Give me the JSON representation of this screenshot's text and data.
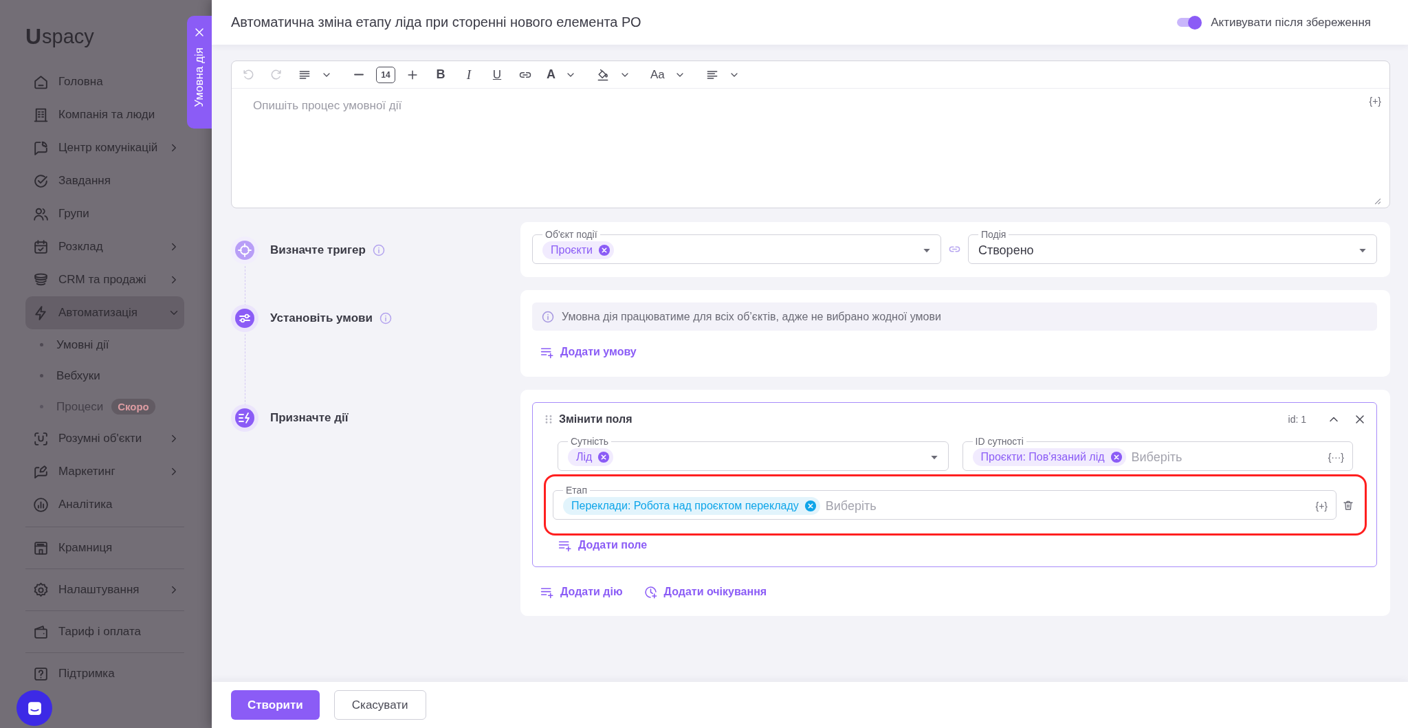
{
  "sidebar": {
    "logo": {
      "mark": "U",
      "text": "spacy"
    },
    "groups": [
      {
        "items": [
          {
            "kind": "home",
            "label": "Головна",
            "expandable": false,
            "expanded": false
          },
          {
            "kind": "company",
            "label": "Компанія та люди",
            "expandable": false,
            "expanded": false
          },
          {
            "kind": "communications",
            "label": "Центр комунікацій",
            "expandable": true,
            "expanded": false
          },
          {
            "kind": "tasks",
            "label": "Завдання",
            "expandable": false,
            "expanded": false
          },
          {
            "kind": "groups",
            "label": "Групи",
            "expandable": false,
            "expanded": false
          },
          {
            "kind": "schedule",
            "label": "Розклад",
            "expandable": true,
            "expanded": false
          },
          {
            "kind": "crm",
            "label": "CRM та продажі",
            "expandable": true,
            "expanded": false
          },
          {
            "kind": "automation",
            "label": "Автоматизація",
            "expandable": true,
            "expanded": true,
            "children": [
              {
                "label": "Умовні дії",
                "disabled": false
              },
              {
                "label": "Вебхуки",
                "disabled": false
              },
              {
                "label": "Процеси",
                "disabled": true,
                "badge": "Скоро"
              }
            ]
          },
          {
            "kind": "smart",
            "label": "Розумні об'єкти",
            "expandable": true,
            "expanded": false
          },
          {
            "kind": "marketing",
            "label": "Маркетинг",
            "expandable": true,
            "expanded": false
          },
          {
            "kind": "analytics",
            "label": "Аналітика",
            "expandable": false,
            "expanded": false
          }
        ]
      },
      {
        "items": [
          {
            "kind": "store",
            "label": "Крамниця",
            "expandable": false,
            "expanded": false
          }
        ]
      },
      {
        "items": [
          {
            "kind": "settings",
            "label": "Налаштування",
            "expandable": true,
            "expanded": false
          }
        ]
      },
      {
        "items": [
          {
            "kind": "billing",
            "label": "Тариф і оплата",
            "expandable": false,
            "expanded": false
          }
        ]
      },
      {
        "items": [
          {
            "kind": "support",
            "label": "Підтримка",
            "expandable": false,
            "expanded": false
          }
        ]
      }
    ]
  },
  "side_tab": {
    "label": "Умовна дія"
  },
  "header": {
    "title": "Автоматична зміна етапу ліда при сторенні нового елемента РО",
    "activate_toggle": {
      "label": "Активувати після збереження",
      "on": true
    }
  },
  "editor": {
    "toolbar": [
      {
        "kind": "undo",
        "disabled": true
      },
      {
        "kind": "redo",
        "disabled": true
      },
      {
        "kind": "paragraph",
        "dropdown": true
      },
      {
        "kind": "minus"
      },
      {
        "kind": "size",
        "label": "14"
      },
      {
        "kind": "plus"
      },
      {
        "kind": "bold",
        "label": "B"
      },
      {
        "kind": "italic",
        "label": "I"
      },
      {
        "kind": "underline",
        "label": "U"
      },
      {
        "kind": "link"
      },
      {
        "kind": "color",
        "label": "A",
        "dropdown": true
      },
      {
        "kind": "fill",
        "dropdown": true
      },
      {
        "kind": "case",
        "label": "Aa",
        "dropdown": true
      },
      {
        "kind": "align",
        "dropdown": true
      }
    ],
    "placeholder": "Опишіть процес умовної дії",
    "variable_button": "{+}"
  },
  "steps": [
    {
      "kind": "trigger",
      "label": "Визначте тригер",
      "info": true,
      "dimmed": true
    },
    {
      "kind": "conditions",
      "label": "Установіть умови",
      "info": true,
      "dimmed": false
    },
    {
      "kind": "actions",
      "label": "Призначте дії",
      "info": false,
      "dimmed": false
    }
  ],
  "trigger": {
    "fields": [
      {
        "kind": "select",
        "label": "Об'єкт події",
        "chips": [
          {
            "text": "Проєкти",
            "color": "#8b5cf6"
          }
        ]
      },
      {
        "kind": "select",
        "label": "Подія",
        "value": "Створено"
      }
    ]
  },
  "conditions": {
    "notice": "Умовна дія працюватиме для всіх об’єктів, адже не вибрано жодної умови",
    "add_link": "Додати умову"
  },
  "actions": {
    "blocks": [
      {
        "title": "Змінити поля",
        "id_label": "id: 1",
        "expanded": true,
        "rows": [
          {
            "highlighted": false,
            "fields": [
              {
                "kind": "select",
                "label": "Сутність",
                "chips": [
                  {
                    "text": "Лід",
                    "color": "#8b5cf6"
                  }
                ],
                "removable": false
              },
              {
                "kind": "variable",
                "label": "ID сутності",
                "chips": [
                  {
                    "text": "Проєкти: Пов'язаний лід",
                    "color": "#8b5cf6"
                  }
                ],
                "placeholder": "Виберіть",
                "variable_button": "{···}",
                "removable": false
              }
            ]
          },
          {
            "highlighted": true,
            "fields": [
              {
                "kind": "variable",
                "label": "Етап",
                "chips": [
                  {
                    "text": "Переклади: Робота над проєктом перекладу",
                    "color": "#0ea5e9"
                  }
                ],
                "placeholder": "Виберіть",
                "variable_button": "{+}",
                "removable": true
              }
            ]
          }
        ],
        "add_field": "Додати поле"
      }
    ],
    "links": [
      {
        "kind": "add-action",
        "label": "Додати дію"
      },
      {
        "kind": "add-wait",
        "label": "Додати очікування"
      }
    ]
  },
  "footer": {
    "buttons": [
      {
        "kind": "primary",
        "label": "Створити"
      },
      {
        "kind": "secondary",
        "label": "Скасувати"
      }
    ]
  }
}
